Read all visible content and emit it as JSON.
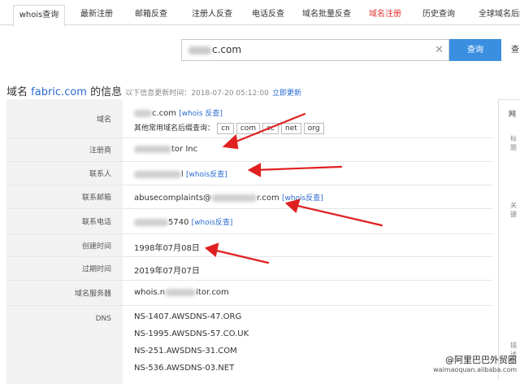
{
  "tabs": [
    {
      "label": "whois查询",
      "active": true
    },
    {
      "label": "最新注册"
    },
    {
      "label": "邮箱反查"
    },
    {
      "label": "注册人反查"
    },
    {
      "label": "电话反查"
    },
    {
      "label": "域名批量反查"
    },
    {
      "label": "域名注册",
      "accent": "#e03030"
    },
    {
      "label": "历史查询"
    },
    {
      "label": "全球域名后缀"
    }
  ],
  "search": {
    "value_suffix": "c.com",
    "clear_icon": "close-icon",
    "button": "查询",
    "cut_label": "查"
  },
  "heading": {
    "prefix": "域名",
    "domain": "fabric.com",
    "suffix": "的信息",
    "updated": "以下信息更新时间：2018-07-20 05:12:00",
    "update_link": "立即更新"
  },
  "rows": {
    "domain": {
      "label": "域名",
      "value_suffix": "c.com",
      "whois_link": "[whois 反查]",
      "other_label": "其他常用域名后缀查询：",
      "suffixes": [
        "cn",
        "com",
        "cc",
        "net",
        "org"
      ]
    },
    "registrar": {
      "label": "注册商",
      "value_suffix": "tor Inc"
    },
    "contact": {
      "label": "联系人",
      "value_suffix": "l",
      "whois_link": "[whois反查]"
    },
    "email": {
      "label": "联系邮箱",
      "value_prefix": "abusecomplaints@",
      "value_suffix": "r.com",
      "whois_link": "[whois反查]"
    },
    "phone": {
      "label": "联系电话",
      "value_suffix": "5740",
      "whois_link": "[whois反查]"
    },
    "created": {
      "label": "创建时间",
      "value": "1998年07月08日"
    },
    "expires": {
      "label": "过期时间",
      "value": "2019年07月07日"
    },
    "server": {
      "label": "域名服务器",
      "value_prefix": "whois.n",
      "value_suffix": "itor.com"
    },
    "dns": {
      "label": "DNS",
      "values": [
        "NS-1407.AWSDNS-47.ORG",
        "NS-1995.AWSDNS-57.CO.UK",
        "NS-251.AWSDNS-31.COM",
        "NS-536.AWSDNS-03.NET"
      ]
    }
  },
  "side": {
    "title": "网",
    "labels": [
      "标题",
      "关键",
      "描述"
    ]
  },
  "watermark": {
    "line1": "@阿里巴巴外贸圈",
    "line2": "waimaoquan.alibaba.com"
  },
  "annotation_color": "#e02020"
}
